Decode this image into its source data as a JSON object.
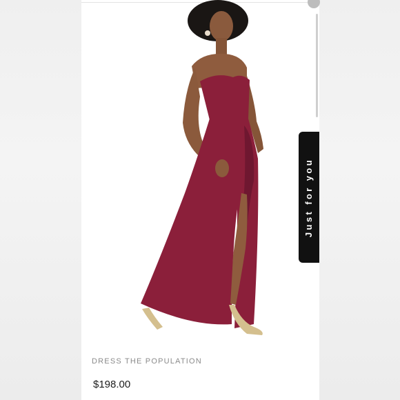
{
  "listing": {
    "brand": "DRESS THE POPULATION",
    "price": "$198.00",
    "image_subject": "model in strapless burgundy maxi dress with side slit"
  },
  "side_tab": {
    "label": "Just for you"
  },
  "colors": {
    "dress": "#8b1f3a",
    "tab_background": "#111111",
    "price_text": "#1c1c1c",
    "brand_text": "#8a8a8a"
  }
}
